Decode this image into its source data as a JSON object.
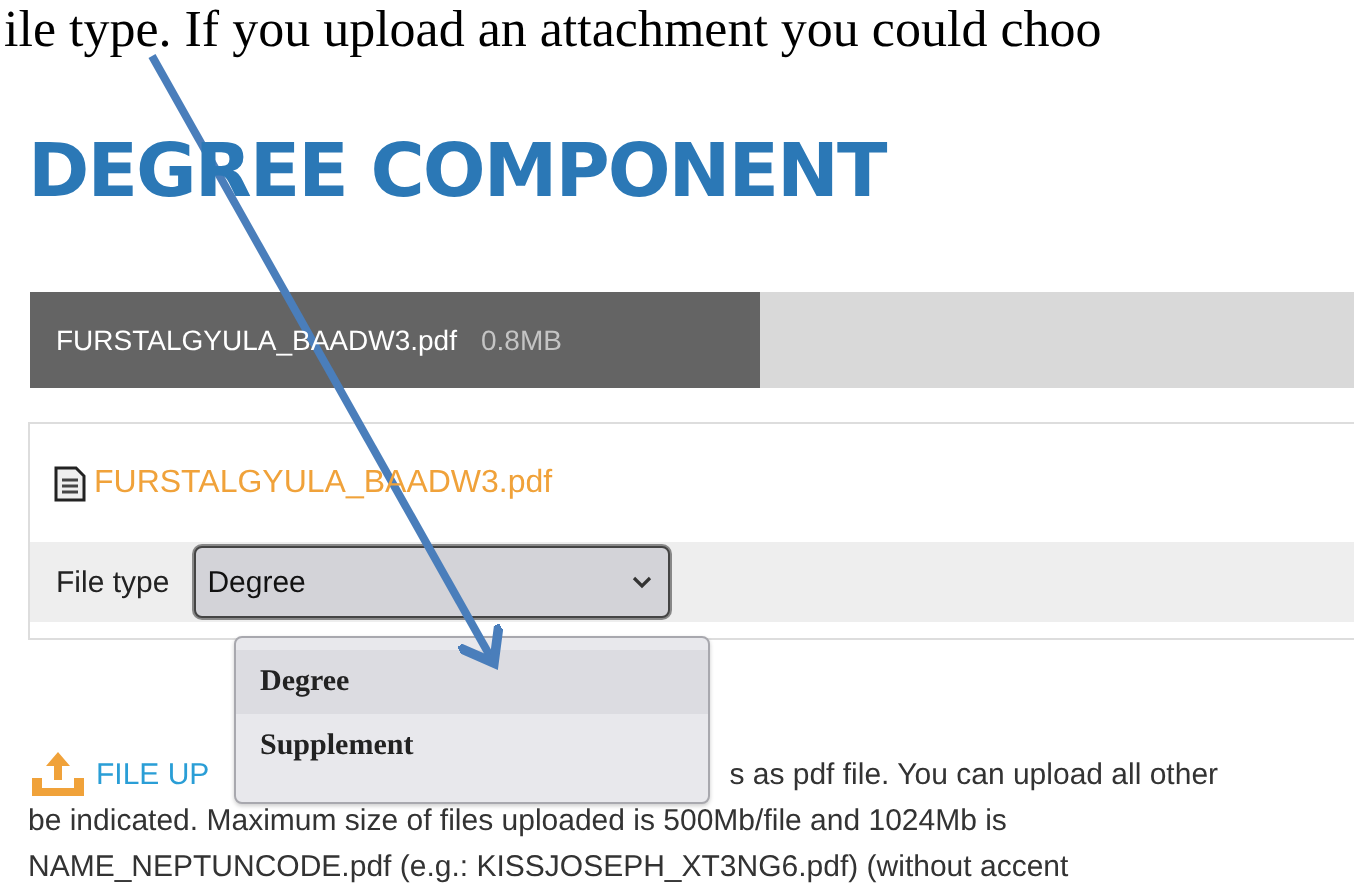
{
  "document_text": "ile type. If you upload an attachment you could choo",
  "heading": "DEGREE COMPONENT",
  "file_bar": {
    "filename": "FURSTALGYULA_BAADW3.pdf",
    "size": "0.8MB"
  },
  "attachment": {
    "filename": "FURSTALGYULA_BAADW3.pdf",
    "file_type": {
      "label": "File type",
      "value": "Degree",
      "expanded": true,
      "options": [
        {
          "label": "Degree",
          "selected": true
        },
        {
          "label": "Supplement",
          "selected": false
        }
      ]
    }
  },
  "upload_info": {
    "title": "FILE UP",
    "line_1": "s as pdf file. You can upload all other",
    "line_2": "be indicated. Maximum size of files uploaded is 500Mb/file and 1024Mb is",
    "line_3": "NAME_NEPTUNCODE.pdf (e.g.: KISSJOSEPH_XT3NG6.pdf) (without accent"
  }
}
